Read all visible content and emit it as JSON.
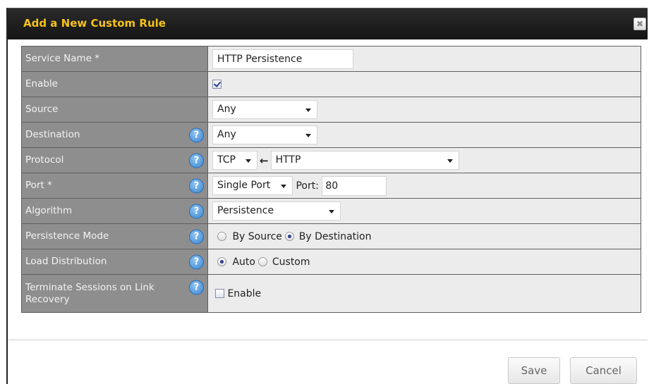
{
  "dialog": {
    "title": "Add a New Custom Rule",
    "close_label": "✖"
  },
  "form": {
    "service_name": {
      "label": "Service Name *",
      "value": "HTTP Persistence"
    },
    "enable": {
      "label": "Enable",
      "checked": true
    },
    "source": {
      "label": "Source",
      "selected": "Any"
    },
    "destination": {
      "label": "Destination",
      "selected": "Any"
    },
    "protocol": {
      "label": "Protocol",
      "selected": "TCP",
      "arrow": "←",
      "service_selected": "HTTP"
    },
    "port": {
      "label": "Port *",
      "selected": "Single Port",
      "port_label": "Port:",
      "port_value": "80"
    },
    "algorithm": {
      "label": "Algorithm",
      "selected": "Persistence"
    },
    "persistence_mode": {
      "label": "Persistence Mode",
      "option_source": "By Source",
      "option_destination": "By Destination",
      "selected": "By Destination"
    },
    "load_distribution": {
      "label": "Load Distribution",
      "option_auto": "Auto",
      "option_custom": "Custom",
      "selected": "Auto"
    },
    "terminate_sessions": {
      "label": "Terminate Sessions on Link Recovery",
      "checkbox_label": "Enable",
      "checked": false
    }
  },
  "help_icon_glyph": "?",
  "buttons": {
    "save": "Save",
    "cancel": "Cancel"
  },
  "colors": {
    "title": "#f4c21b",
    "label_bg": "#8e8e8e",
    "value_bg": "#ececec",
    "help_icon": "#3a84cf"
  }
}
